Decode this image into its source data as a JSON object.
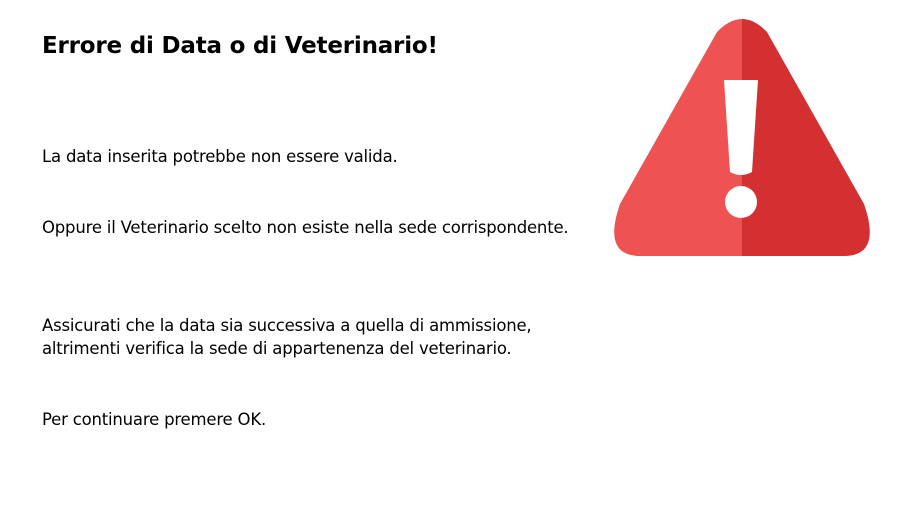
{
  "dialog": {
    "title": "Errore di Data o di Veterinario!",
    "messages": [
      "La data inserita potrebbe non essere valida.",
      "Oppure il Veterinario scelto non esiste nella sede corrispondente.",
      "Assicurati che la data sia successiva a quella di ammissione, altrimenti verifica la sede di appartenenza del veterinario.",
      "Per continuare premere OK."
    ],
    "icon": "warning-triangle-icon",
    "colors": {
      "icon_left": "#EE5253",
      "icon_right": "#D43032",
      "icon_mark": "#FFFFFF",
      "text": "#000000",
      "background": "#FFFFFF"
    }
  }
}
